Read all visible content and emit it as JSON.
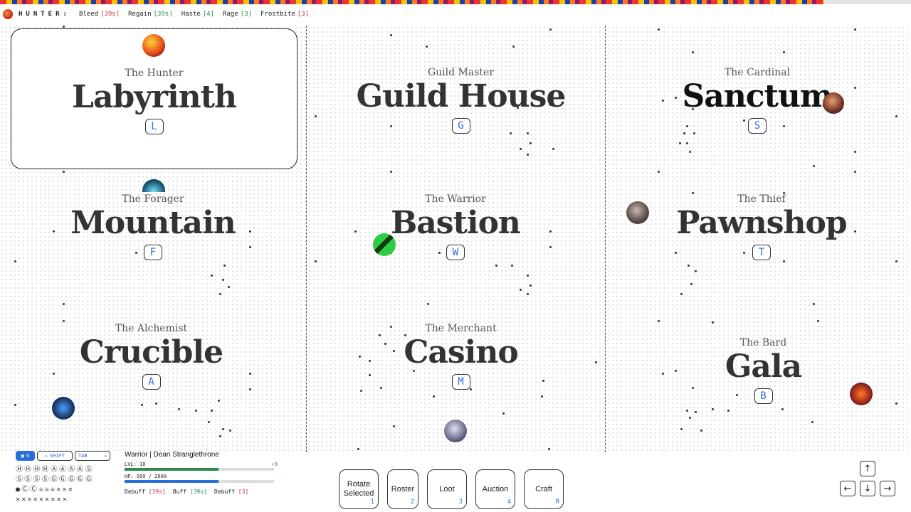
{
  "game": {
    "title": "HUNTER:",
    "effects": [
      {
        "name": "Bleed",
        "value": "[39s]",
        "tone": "red"
      },
      {
        "name": "Regain",
        "value": "[39s]",
        "tone": "green"
      },
      {
        "name": "Haste",
        "value": "[4]",
        "tone": "green"
      },
      {
        "name": "Rage",
        "value": "[3]",
        "tone": "green"
      },
      {
        "name": "Frostbite",
        "value": "[3]",
        "tone": "red"
      }
    ]
  },
  "locations": [
    {
      "owner": "The Hunter",
      "name": "Labyrinth",
      "key": "L",
      "selected": true
    },
    {
      "owner": "Guild Master",
      "name": "Guild House",
      "key": "G"
    },
    {
      "owner": "The Cardinal",
      "name": "Sanctum",
      "key": "S"
    },
    {
      "owner": "The Forager",
      "name": "Mountain",
      "key": "F"
    },
    {
      "owner": "The Warrior",
      "name": "Bastion",
      "key": "W"
    },
    {
      "owner": "The Thief",
      "name": "Pawnshop",
      "key": "T"
    },
    {
      "owner": "The Alchemist",
      "name": "Crucible",
      "key": "A"
    },
    {
      "owner": "The Merchant",
      "name": "Casino",
      "key": "M"
    },
    {
      "owner": "The Bard",
      "name": "Gala",
      "key": "B"
    }
  ],
  "hud": {
    "view_label": "G",
    "shift_label": "SHIFT",
    "tab_label": "TAB",
    "glyph_rows": [
      "ⒽⒽⒽⒽⒶⒶⒶⒶⓈ",
      "ⓈⓈⓈⓈⒼⒼⒼⒼⒼ",
      "●ⒸⒸ☠☠☠✕✕✕",
      "✕✕✕✕✕✕✕✕✕"
    ]
  },
  "character": {
    "name": "Warrior | Dean Stranglethrone",
    "lvl_label": "LVL:",
    "lvl": "10",
    "lvl_gain": "+9",
    "lvl_progress": 0.63,
    "hp_label": "HP:",
    "hp": "999",
    "hp_max": "/ 2000",
    "hp_progress": 0.63,
    "buffs": [
      {
        "name": "Debuff",
        "value": "[39s]",
        "tone": "red"
      },
      {
        "name": "Buff",
        "value": "[39s]",
        "tone": "green"
      },
      {
        "name": "Debuff",
        "value": "[3]",
        "tone": "red"
      }
    ]
  },
  "actions": [
    {
      "label": "Rotate Selected",
      "key": "1"
    },
    {
      "label": "Roster",
      "key": "2"
    },
    {
      "label": "Loot",
      "key": "3"
    },
    {
      "label": "Auction",
      "key": "4"
    },
    {
      "label": "Craft",
      "key": "R"
    }
  ],
  "arrows": {
    "up": "↑",
    "left": "←",
    "down": "↓",
    "right": "→"
  },
  "colors": {
    "accent": "#2b6fd6",
    "hp": "#2b6fd6",
    "lvl": "#2f8a4e",
    "debuff": "#c8323a",
    "buff": "#2f8a4e"
  }
}
